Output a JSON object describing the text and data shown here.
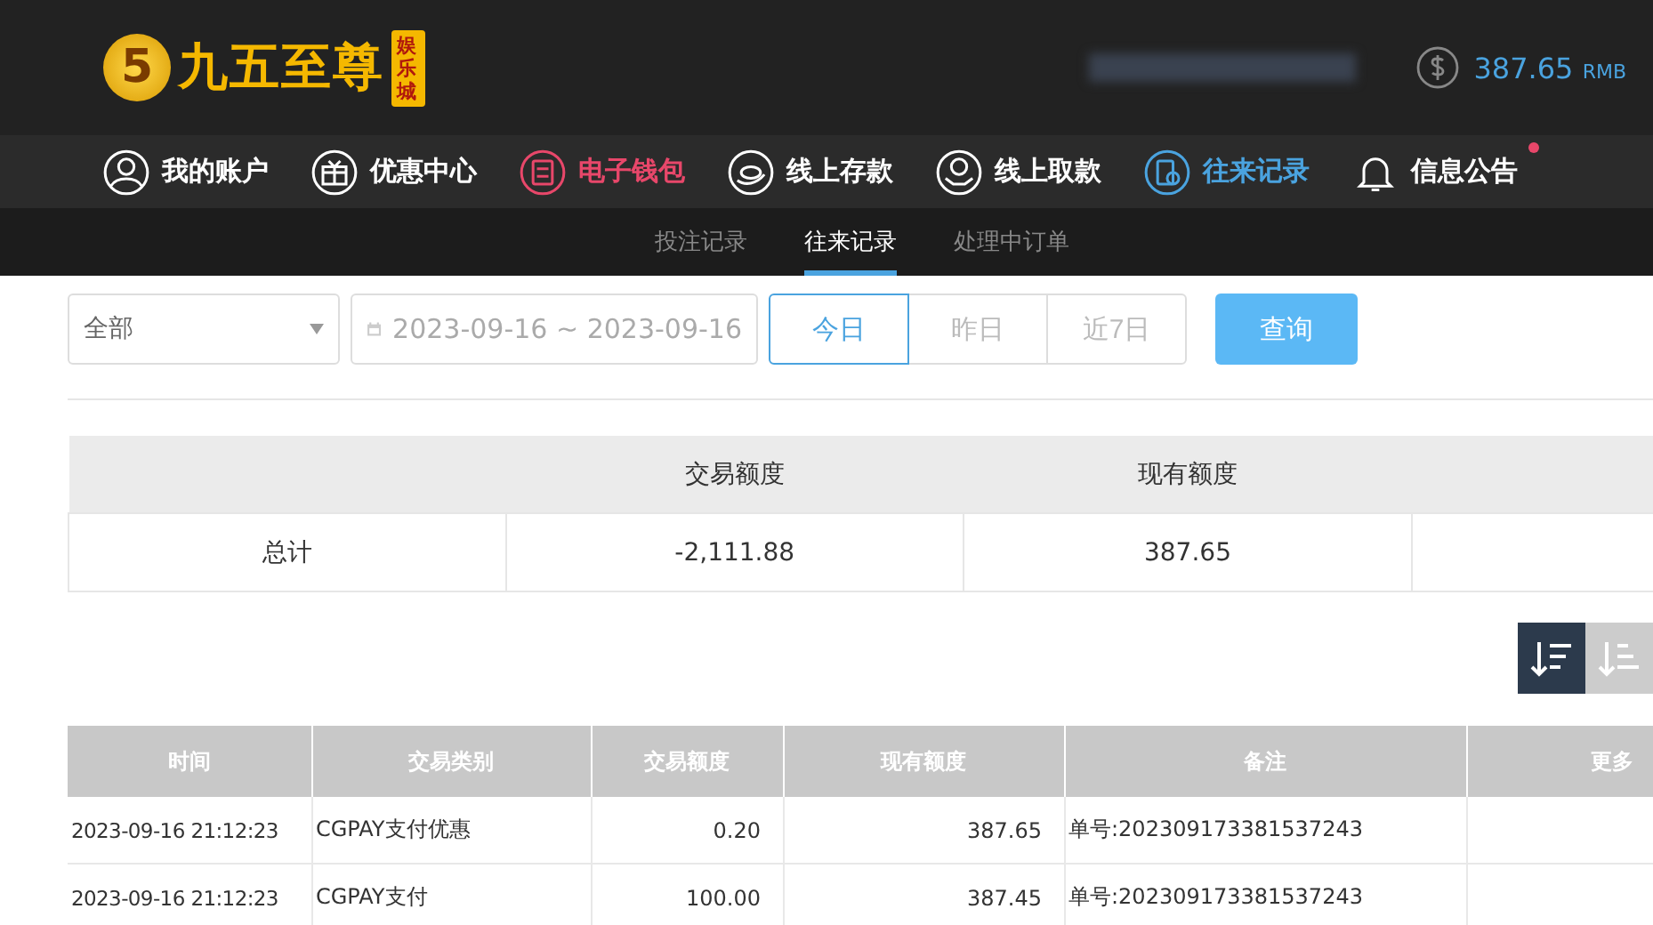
{
  "header": {
    "logo": {
      "mark": "5",
      "name": "九五至尊",
      "tag": "娱乐城"
    },
    "balance": "387.65",
    "currency": "RMB"
  },
  "nav": [
    {
      "label": "我的账户",
      "color": "#ffffff",
      "badge": false
    },
    {
      "label": "优惠中心",
      "color": "#ffffff",
      "badge": false
    },
    {
      "label": "电子钱包",
      "color": "#e8476a",
      "badge": false
    },
    {
      "label": "线上存款",
      "color": "#ffffff",
      "badge": false
    },
    {
      "label": "线上取款",
      "color": "#ffffff",
      "badge": false
    },
    {
      "label": "往来记录",
      "color": "#4aa3df",
      "badge": false
    },
    {
      "label": "信息公告",
      "color": "#ffffff",
      "badge": true
    }
  ],
  "subtabs": [
    {
      "label": "投注记录",
      "selected": false
    },
    {
      "label": "往来记录",
      "selected": true
    },
    {
      "label": "处理中订单",
      "selected": false
    }
  ],
  "filter": {
    "type": "全部",
    "date_range": "2023-09-16 ~ 2023-09-16",
    "ranges": [
      {
        "label": "今日",
        "selected": true
      },
      {
        "label": "昨日",
        "selected": false
      },
      {
        "label": "近7日",
        "selected": false
      }
    ],
    "query": "查询"
  },
  "summary": {
    "columns": [
      "交易额度",
      "现有额度"
    ],
    "row": {
      "label": "总计",
      "values": [
        "-2,111.88",
        "387.65"
      ]
    }
  },
  "sort": [
    {
      "selected": true
    },
    {
      "selected": false
    }
  ],
  "table": {
    "columns": [
      "时间",
      "交易类别",
      "交易额度",
      "现有额度",
      "备注",
      "更多"
    ],
    "rows": [
      [
        "2023-09-16 21:12:23",
        "CGPAY支付优惠",
        "0.20",
        "387.65",
        "单号:202309173381537243"
      ],
      [
        "2023-09-16 21:12:23",
        "CGPAY支付",
        "100.00",
        "387.45",
        "单号:202309173381537243"
      ]
    ]
  }
}
